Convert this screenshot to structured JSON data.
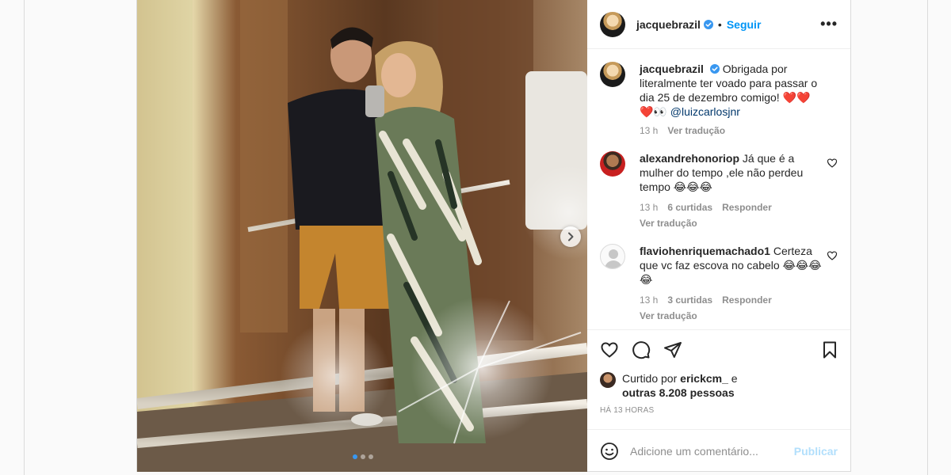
{
  "header": {
    "username": "jacquebrazil",
    "bullet": "•",
    "follow_label": "Seguir",
    "more_label": "•••"
  },
  "caption": {
    "username": "jacquebrazil",
    "text": "Obrigada por literalmente ter voado para passar o dia 25 de dezembro comigo! ❤️❤️❤️👀",
    "mention": "@luizcarlosjnr",
    "time": "13 h",
    "translate": "Ver tradução"
  },
  "comments": [
    {
      "username": "alexandrehonoriop",
      "text": "Já que é a mulher do tempo ,ele não perdeu tempo 😂😂😂",
      "time": "13 h",
      "likes": "6 curtidas",
      "reply": "Responder",
      "translate": "Ver tradução"
    },
    {
      "username": "flaviohenriquemachado1",
      "text": "Certeza que vc faz escova no cabelo 😂😂😂😂",
      "time": "13 h",
      "likes": "3 curtidas",
      "reply": "Responder",
      "translate": "Ver tradução"
    }
  ],
  "likes": {
    "prefix": "Curtido por",
    "liker": "erickcm_",
    "conj": "e",
    "others": "outras 8.208 pessoas"
  },
  "timestamp": "HÁ 13 HORAS",
  "composer": {
    "placeholder": "Adicione um comentário...",
    "publish_label": "Publicar"
  },
  "carousel": {
    "slides": 3,
    "current": 1
  },
  "colors": {
    "accent": "#0095f6",
    "verified": "#3897f0",
    "publish_disabled": "#b2dffc",
    "muted": "#8e8e8e"
  },
  "icons": [
    "verified-icon",
    "more-icon",
    "heart-icon",
    "comment-icon",
    "share-icon",
    "bookmark-icon",
    "emoji-icon",
    "chevron-right-icon"
  ]
}
